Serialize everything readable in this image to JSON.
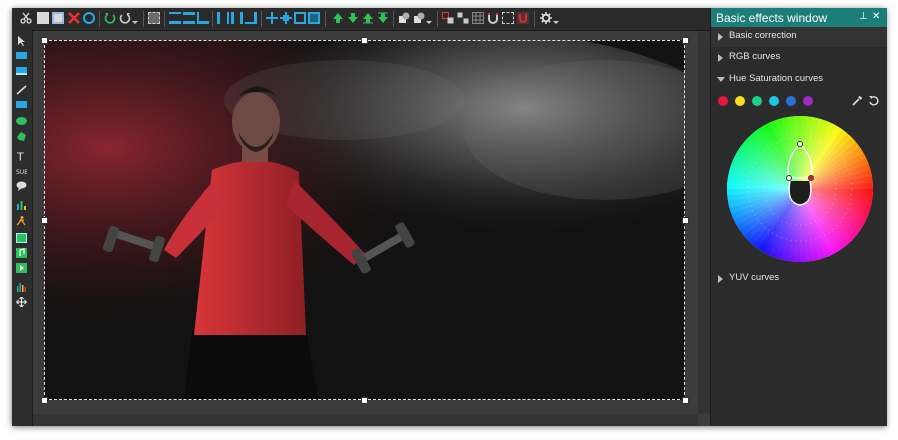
{
  "panel": {
    "title": "Basic effects window",
    "sections": [
      {
        "label": "Basic correction",
        "expanded": false
      },
      {
        "label": "RGB curves",
        "expanded": false
      },
      {
        "label": "Hue Saturation curves",
        "expanded": true
      },
      {
        "label": "YUV curves",
        "expanded": false
      }
    ],
    "swatch_colors": [
      "#e8193f",
      "#f4e01e",
      "#1fcf86",
      "#1bc7e2",
      "#2c6fd6",
      "#9b2ec4"
    ],
    "pin_glyph": "⊥",
    "close_glyph": "✕"
  },
  "colors": {
    "accent": "#1c7e78",
    "panel_bg": "#2b2b2b",
    "toolbar_green": "#2ec05a",
    "toolbar_blue": "#27a8e0",
    "toolbar_red": "#e8322b"
  }
}
